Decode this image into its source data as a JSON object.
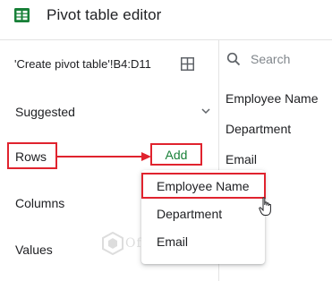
{
  "header": {
    "title": "Pivot table editor",
    "icon": "sheets-icon"
  },
  "source_range": "'Create pivot table'!B4:D11",
  "sections": {
    "suggested": "Suggested",
    "rows": "Rows",
    "columns": "Columns",
    "values": "Values"
  },
  "add_button": "Add",
  "dropdown": {
    "items": [
      "Employee Name",
      "Department",
      "Email"
    ],
    "highlighted_item": "Employee Name"
  },
  "field_search": {
    "placeholder": "Search"
  },
  "fields": [
    "Employee Name",
    "Department",
    "Email"
  ],
  "watermark": "OfficeWheel",
  "colors": {
    "highlight": "#e0232e",
    "add_text": "#188038",
    "sheets_green": "#188038"
  }
}
